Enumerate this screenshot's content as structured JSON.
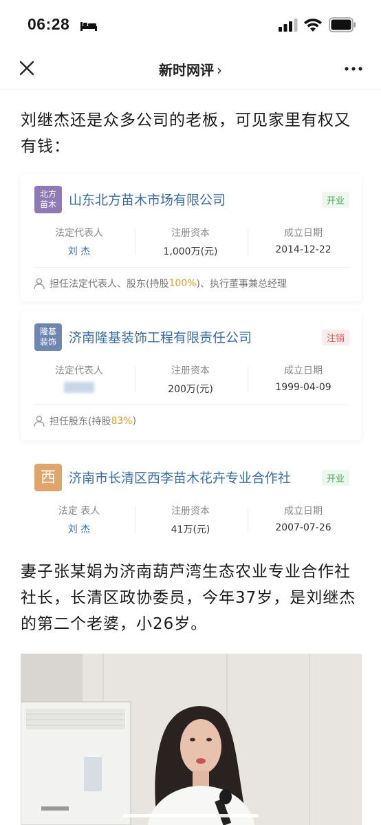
{
  "status_bar": {
    "time": "06:28"
  },
  "nav": {
    "title": "新时网评",
    "chevron": "›"
  },
  "article": {
    "para1": "刘继杰还是众多公司的老板，可见家里有权又有钱：",
    "para2": "妻子张某娟为济南葫芦湾生态农业专业合作社社长，长清区政协委员，今年37岁，是刘继杰的第二个老婆，小26岁。"
  },
  "labels": {
    "legal_rep": "法定代表人",
    "reg_capital": "注册资本",
    "est_date": "成立日期"
  },
  "companies": [
    {
      "logo": "北方\n苗木",
      "name": "山东北方苗木市场有限公司",
      "status": "开业",
      "legal_rep_label": "法定代表人",
      "legal_rep": "刘 杰",
      "capital": "1,000万(元)",
      "date": "2014-12-22",
      "role_prefix": "担任法定代表人、股东(持股",
      "role_pct": "100%",
      "role_suffix": ")、执行董事兼总经理"
    },
    {
      "logo": "隆基\n装饰",
      "name": "济南隆基装饰工程有限责任公司",
      "status": "注销",
      "legal_rep_label": "法定代表人",
      "legal_rep": "",
      "capital": "200万(元)",
      "date": "1999-04-09",
      "role_prefix": "担任股东(持股",
      "role_pct": "83%",
      "role_suffix": ")"
    },
    {
      "logo": "西",
      "name": "济南市长清区西李苗木花卉专业合作社",
      "status": "开业",
      "legal_rep_label": "法定 表人",
      "legal_rep": "刘 杰",
      "capital": "41万(元)",
      "date": "2007-07-26"
    }
  ],
  "colors": {
    "link_blue": "#3b6ea5",
    "open_green": "#4aa35b",
    "cancel_red": "#d9534f",
    "pct_orange": "#e39b2e"
  },
  "icons": [
    "bed-icon",
    "signal-icon",
    "wifi-icon",
    "battery-icon",
    "close-icon",
    "more-icon",
    "person-icon"
  ]
}
